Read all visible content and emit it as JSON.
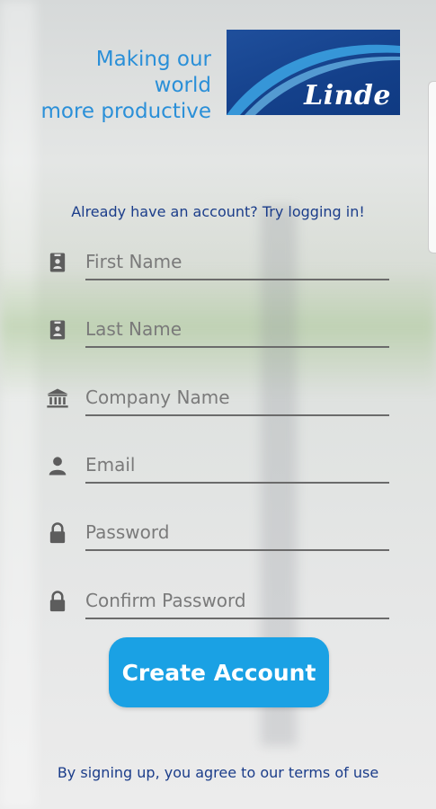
{
  "header": {
    "tagline_line1": "Making our world",
    "tagline_line2": "more productive",
    "logo_text": "Linde",
    "logo_color": "#1a4a96",
    "tagline_color": "#2a8fd8"
  },
  "login_prompt": "Already have an account? Try logging in!",
  "form": {
    "first_name": {
      "placeholder": "First Name",
      "icon": "id-badge-icon"
    },
    "last_name": {
      "placeholder": "Last Name",
      "icon": "id-badge-icon"
    },
    "company_name": {
      "placeholder": "Company Name",
      "icon": "bank-icon"
    },
    "email": {
      "placeholder": "Email",
      "icon": "person-icon"
    },
    "password": {
      "placeholder": "Password",
      "icon": "lock-icon"
    },
    "confirm_password": {
      "placeholder": "Confirm Password",
      "icon": "lock-icon"
    }
  },
  "create_button": {
    "label": "Create Account",
    "color": "#1aa1e4"
  },
  "terms_text": "By signing up, you agree to our terms of use"
}
